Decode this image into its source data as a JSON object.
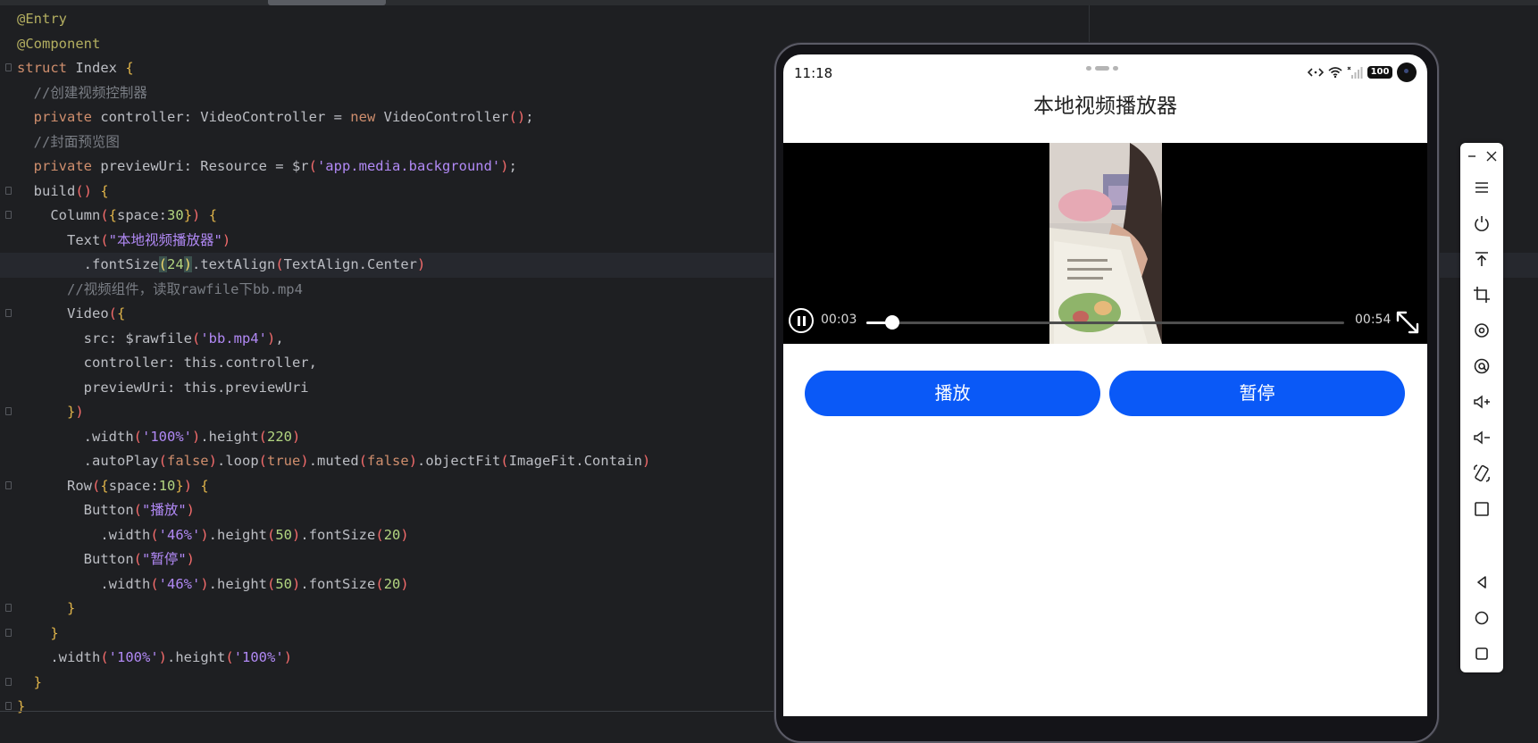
{
  "code": {
    "lines": [
      [
        {
          "c": "t-ann",
          "t": "@Entry"
        }
      ],
      [
        {
          "c": "t-ann",
          "t": "@Component"
        }
      ],
      [
        {
          "c": "t-kw",
          "t": "struct "
        },
        {
          "c": "t-fn",
          "t": "Index "
        },
        {
          "c": "t-br1",
          "t": "{"
        }
      ],
      [
        {
          "c": "t-com",
          "t": "  //创建视频控制器"
        }
      ],
      [
        {
          "c": "t-kw",
          "t": "  private "
        },
        {
          "c": "t-fn",
          "t": "controller: VideoController = "
        },
        {
          "c": "t-kw",
          "t": "new "
        },
        {
          "c": "t-fn",
          "t": "VideoController"
        },
        {
          "c": "t-br2",
          "t": "()"
        },
        {
          "c": "t-pun",
          "t": ";"
        }
      ],
      [
        {
          "c": "t-com",
          "t": "  //封面预览图"
        }
      ],
      [
        {
          "c": "t-kw",
          "t": "  private "
        },
        {
          "c": "t-fn",
          "t": "previewUri: Resource = $r"
        },
        {
          "c": "t-br2",
          "t": "("
        },
        {
          "c": "t-str",
          "t": "'app.media.background'"
        },
        {
          "c": "t-br2",
          "t": ")"
        },
        {
          "c": "t-pun",
          "t": ";"
        }
      ],
      [
        {
          "c": "t-fn",
          "t": "  build"
        },
        {
          "c": "t-br2",
          "t": "() "
        },
        {
          "c": "t-br1",
          "t": "{"
        }
      ],
      [
        {
          "c": "t-fn",
          "t": "    Column"
        },
        {
          "c": "t-br2",
          "t": "("
        },
        {
          "c": "t-br1",
          "t": "{"
        },
        {
          "c": "t-fn",
          "t": "space:"
        },
        {
          "c": "t-num",
          "t": "30"
        },
        {
          "c": "t-br1",
          "t": "}"
        },
        {
          "c": "t-br2",
          "t": ") "
        },
        {
          "c": "t-br1",
          "t": "{"
        }
      ],
      [
        {
          "c": "t-fn",
          "t": "      Text"
        },
        {
          "c": "t-br2",
          "t": "("
        },
        {
          "c": "t-str",
          "t": "\"本地视频播放器\""
        },
        {
          "c": "t-br2",
          "t": ")"
        }
      ],
      [
        {
          "c": "t-fn",
          "t": "        .fontSize"
        },
        {
          "c": "t-cur",
          "t": "("
        },
        {
          "c": "t-num",
          "t": "24"
        },
        {
          "c": "t-cur",
          "t": ")"
        },
        {
          "c": "t-fn",
          "t": ".textAlign"
        },
        {
          "c": "t-br2",
          "t": "("
        },
        {
          "c": "t-fn",
          "t": "TextAlign.Center"
        },
        {
          "c": "t-br2",
          "t": ")"
        }
      ],
      [
        {
          "c": "t-com",
          "t": "      //视频组件，读取rawfile下bb.mp4"
        }
      ],
      [
        {
          "c": "t-fn",
          "t": "      Video"
        },
        {
          "c": "t-br2",
          "t": "("
        },
        {
          "c": "t-br1",
          "t": "{"
        }
      ],
      [
        {
          "c": "t-fn",
          "t": "        src: $rawfile"
        },
        {
          "c": "t-br2",
          "t": "("
        },
        {
          "c": "t-str",
          "t": "'bb.mp4'"
        },
        {
          "c": "t-br2",
          "t": ")"
        },
        {
          "c": "t-pun",
          "t": ","
        }
      ],
      [
        {
          "c": "t-fn",
          "t": "        controller: this.controller,"
        }
      ],
      [
        {
          "c": "t-fn",
          "t": "        previewUri: this.previewUri"
        }
      ],
      [
        {
          "c": "t-br1",
          "t": "      }"
        },
        {
          "c": "t-br2",
          "t": ")"
        }
      ],
      [
        {
          "c": "t-fn",
          "t": "        .width"
        },
        {
          "c": "t-br2",
          "t": "("
        },
        {
          "c": "t-str",
          "t": "'100%'"
        },
        {
          "c": "t-br2",
          "t": ")"
        },
        {
          "c": "t-fn",
          "t": ".height"
        },
        {
          "c": "t-br2",
          "t": "("
        },
        {
          "c": "t-num",
          "t": "220"
        },
        {
          "c": "t-br2",
          "t": ")"
        }
      ],
      [
        {
          "c": "t-fn",
          "t": "        .autoPlay"
        },
        {
          "c": "t-br2",
          "t": "("
        },
        {
          "c": "t-kw",
          "t": "false"
        },
        {
          "c": "t-br2",
          "t": ")"
        },
        {
          "c": "t-fn",
          "t": ".loop"
        },
        {
          "c": "t-br2",
          "t": "("
        },
        {
          "c": "t-kw",
          "t": "true"
        },
        {
          "c": "t-br2",
          "t": ")"
        },
        {
          "c": "t-fn",
          "t": ".muted"
        },
        {
          "c": "t-br2",
          "t": "("
        },
        {
          "c": "t-kw",
          "t": "false"
        },
        {
          "c": "t-br2",
          "t": ")"
        },
        {
          "c": "t-fn",
          "t": ".objectFit"
        },
        {
          "c": "t-br2",
          "t": "("
        },
        {
          "c": "t-fn",
          "t": "ImageFit.Contain"
        },
        {
          "c": "t-br2",
          "t": ")"
        }
      ],
      [
        {
          "c": "t-fn",
          "t": "      Row"
        },
        {
          "c": "t-br2",
          "t": "("
        },
        {
          "c": "t-br1",
          "t": "{"
        },
        {
          "c": "t-fn",
          "t": "space:"
        },
        {
          "c": "t-num",
          "t": "10"
        },
        {
          "c": "t-br1",
          "t": "}"
        },
        {
          "c": "t-br2",
          "t": ") "
        },
        {
          "c": "t-br1",
          "t": "{"
        }
      ],
      [
        {
          "c": "t-fn",
          "t": "        Button"
        },
        {
          "c": "t-br2",
          "t": "("
        },
        {
          "c": "t-str",
          "t": "\"播放\""
        },
        {
          "c": "t-br2",
          "t": ")"
        }
      ],
      [
        {
          "c": "t-fn",
          "t": "          .width"
        },
        {
          "c": "t-br2",
          "t": "("
        },
        {
          "c": "t-str",
          "t": "'46%'"
        },
        {
          "c": "t-br2",
          "t": ")"
        },
        {
          "c": "t-fn",
          "t": ".height"
        },
        {
          "c": "t-br2",
          "t": "("
        },
        {
          "c": "t-num",
          "t": "50"
        },
        {
          "c": "t-br2",
          "t": ")"
        },
        {
          "c": "t-fn",
          "t": ".fontSize"
        },
        {
          "c": "t-br2",
          "t": "("
        },
        {
          "c": "t-num",
          "t": "20"
        },
        {
          "c": "t-br2",
          "t": ")"
        }
      ],
      [
        {
          "c": "t-fn",
          "t": "        Button"
        },
        {
          "c": "t-br2",
          "t": "("
        },
        {
          "c": "t-str",
          "t": "\"暂停\""
        },
        {
          "c": "t-br2",
          "t": ")"
        }
      ],
      [
        {
          "c": "t-fn",
          "t": "          .width"
        },
        {
          "c": "t-br2",
          "t": "("
        },
        {
          "c": "t-str",
          "t": "'46%'"
        },
        {
          "c": "t-br2",
          "t": ")"
        },
        {
          "c": "t-fn",
          "t": ".height"
        },
        {
          "c": "t-br2",
          "t": "("
        },
        {
          "c": "t-num",
          "t": "50"
        },
        {
          "c": "t-br2",
          "t": ")"
        },
        {
          "c": "t-fn",
          "t": ".fontSize"
        },
        {
          "c": "t-br2",
          "t": "("
        },
        {
          "c": "t-num",
          "t": "20"
        },
        {
          "c": "t-br2",
          "t": ")"
        }
      ],
      [
        {
          "c": "t-br1",
          "t": "      }"
        }
      ],
      [
        {
          "c": "t-br1",
          "t": "    }"
        }
      ],
      [
        {
          "c": "t-fn",
          "t": "    .width"
        },
        {
          "c": "t-br2",
          "t": "("
        },
        {
          "c": "t-str",
          "t": "'100%'"
        },
        {
          "c": "t-br2",
          "t": ")"
        },
        {
          "c": "t-fn",
          "t": ".height"
        },
        {
          "c": "t-br2",
          "t": "("
        },
        {
          "c": "t-str",
          "t": "'100%'"
        },
        {
          "c": "t-br2",
          "t": ")"
        }
      ],
      [
        {
          "c": "t-br1",
          "t": "  }"
        }
      ],
      [
        {
          "c": "t-br1",
          "t": "}"
        }
      ]
    ],
    "current_line": 10
  },
  "phone": {
    "status": {
      "time": "11:18",
      "battery": "100"
    },
    "app_title": "本地视频播放器",
    "video": {
      "current_time": "00:03",
      "total_time": "00:54",
      "progress": 0.055
    },
    "buttons": {
      "play_label": "播放",
      "pause_label": "暂停",
      "color": "#0a59f7"
    }
  },
  "toolbar": {
    "icons": [
      "minimize-icon",
      "close-icon",
      "menu-icon",
      "power-icon",
      "pin-top-icon",
      "crop-icon",
      "rotate-icon",
      "location-icon",
      "volume-up-icon",
      "volume-down-icon",
      "rotate-device-icon",
      "fullscreen-icon",
      "back-icon",
      "home-icon",
      "recent-apps-icon"
    ]
  },
  "colors": {
    "editor_bg": "#1e1f22",
    "keyword": "#cf8e6d",
    "string": "#b189f5",
    "number": "#b3d681",
    "comment": "#7a7e85"
  }
}
